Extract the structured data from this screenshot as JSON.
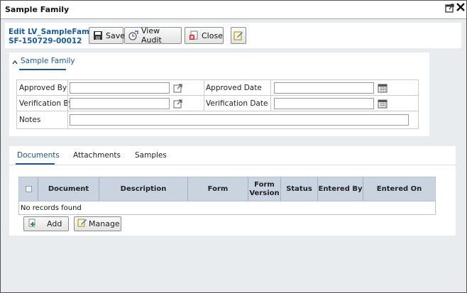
{
  "window": {
    "title": "Sample Family"
  },
  "header": {
    "record_line1": "Edit LV_SampleFamily",
    "record_line2": "SF-150729-00012",
    "save_label": "Save",
    "audit_label": "View Audit",
    "close_label": "Close"
  },
  "section": {
    "tab_label": "Sample Family"
  },
  "form": {
    "approved_by_label": "Approved By",
    "approved_by_value": "",
    "approved_date_label": "Approved Date",
    "approved_date_value": "",
    "verification_by_label": "Verification By",
    "verification_by_value": "",
    "verification_date_label": "Verification Date",
    "verification_date_value": "",
    "notes_label": "Notes",
    "notes_value": ""
  },
  "tabs": {
    "documents": "Documents",
    "attachments": "Attachments",
    "samples": "Samples"
  },
  "grid": {
    "columns": [
      "Document",
      "Description",
      "Form",
      "Form Version",
      "Status",
      "Entered By",
      "Entered On"
    ],
    "empty_text": "No records found"
  },
  "actions": {
    "add_label": "Add",
    "manage_label": "Manage"
  },
  "colors": {
    "accent": "#1a5a9c",
    "header_bg": "#cad4e0",
    "window_bg": "#e9ecef"
  },
  "icons": [
    "restore-icon",
    "close-icon",
    "save-icon",
    "audit-icon",
    "close-doc-icon",
    "edit-note-icon",
    "open-link-icon",
    "calendar-icon",
    "add-icon",
    "manage-icon",
    "chevron-up-icon"
  ]
}
